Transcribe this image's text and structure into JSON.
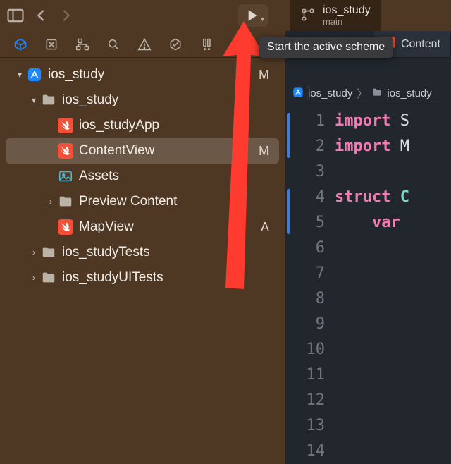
{
  "toolbar": {
    "tooltip": "Start the active scheme"
  },
  "scheme": {
    "name": "ios_study",
    "branch": "main"
  },
  "navigator": {
    "root": {
      "name": "ios_study",
      "status": "M"
    },
    "items": [
      {
        "name": "ios_study",
        "kind": "folder",
        "depth": 1,
        "open": true,
        "status": ""
      },
      {
        "name": "ios_studyApp",
        "kind": "swift",
        "depth": 2,
        "status": ""
      },
      {
        "name": "ContentView",
        "kind": "swift",
        "depth": 2,
        "status": "M",
        "selected": true
      },
      {
        "name": "Assets",
        "kind": "assets",
        "depth": 2,
        "status": ""
      },
      {
        "name": "Preview Content",
        "kind": "folder",
        "depth": 2,
        "status": "",
        "closed": true
      },
      {
        "name": "MapView",
        "kind": "swift",
        "depth": 2,
        "status": "A"
      },
      {
        "name": "ios_studyTests",
        "kind": "folder",
        "depth": 1,
        "status": "",
        "closed": true
      },
      {
        "name": "ios_studyUITests",
        "kind": "folder",
        "depth": 1,
        "status": "",
        "closed": true
      }
    ]
  },
  "tabs": {
    "active": {
      "name": "Content",
      "icon": "swift"
    }
  },
  "breadcrumb": {
    "seg1": "ios_study",
    "seg2": "ios_study"
  },
  "code": {
    "lines": [
      {
        "n": 1,
        "tokens": [
          [
            "kw",
            "import"
          ],
          [
            "sp",
            " "
          ],
          [
            "id",
            "S"
          ]
        ]
      },
      {
        "n": 2,
        "tokens": [
          [
            "kw",
            "import"
          ],
          [
            "sp",
            " "
          ],
          [
            "id",
            "M"
          ]
        ]
      },
      {
        "n": 3,
        "tokens": []
      },
      {
        "n": 4,
        "tokens": [
          [
            "kw",
            "struct"
          ],
          [
            "sp",
            " "
          ],
          [
            "ty",
            "C"
          ]
        ]
      },
      {
        "n": 5,
        "tokens": [
          [
            "sp",
            "    "
          ],
          [
            "kw",
            "var"
          ]
        ]
      },
      {
        "n": 6,
        "tokens": []
      },
      {
        "n": 7,
        "tokens": []
      },
      {
        "n": 8,
        "tokens": []
      },
      {
        "n": 9,
        "tokens": []
      },
      {
        "n": 10,
        "tokens": []
      },
      {
        "n": 11,
        "tokens": []
      },
      {
        "n": 12,
        "tokens": []
      },
      {
        "n": 13,
        "tokens": []
      },
      {
        "n": 14,
        "tokens": []
      }
    ],
    "fold_ranges": [
      {
        "from": 1,
        "to": 2
      },
      {
        "from": 4,
        "to": 5
      }
    ]
  }
}
